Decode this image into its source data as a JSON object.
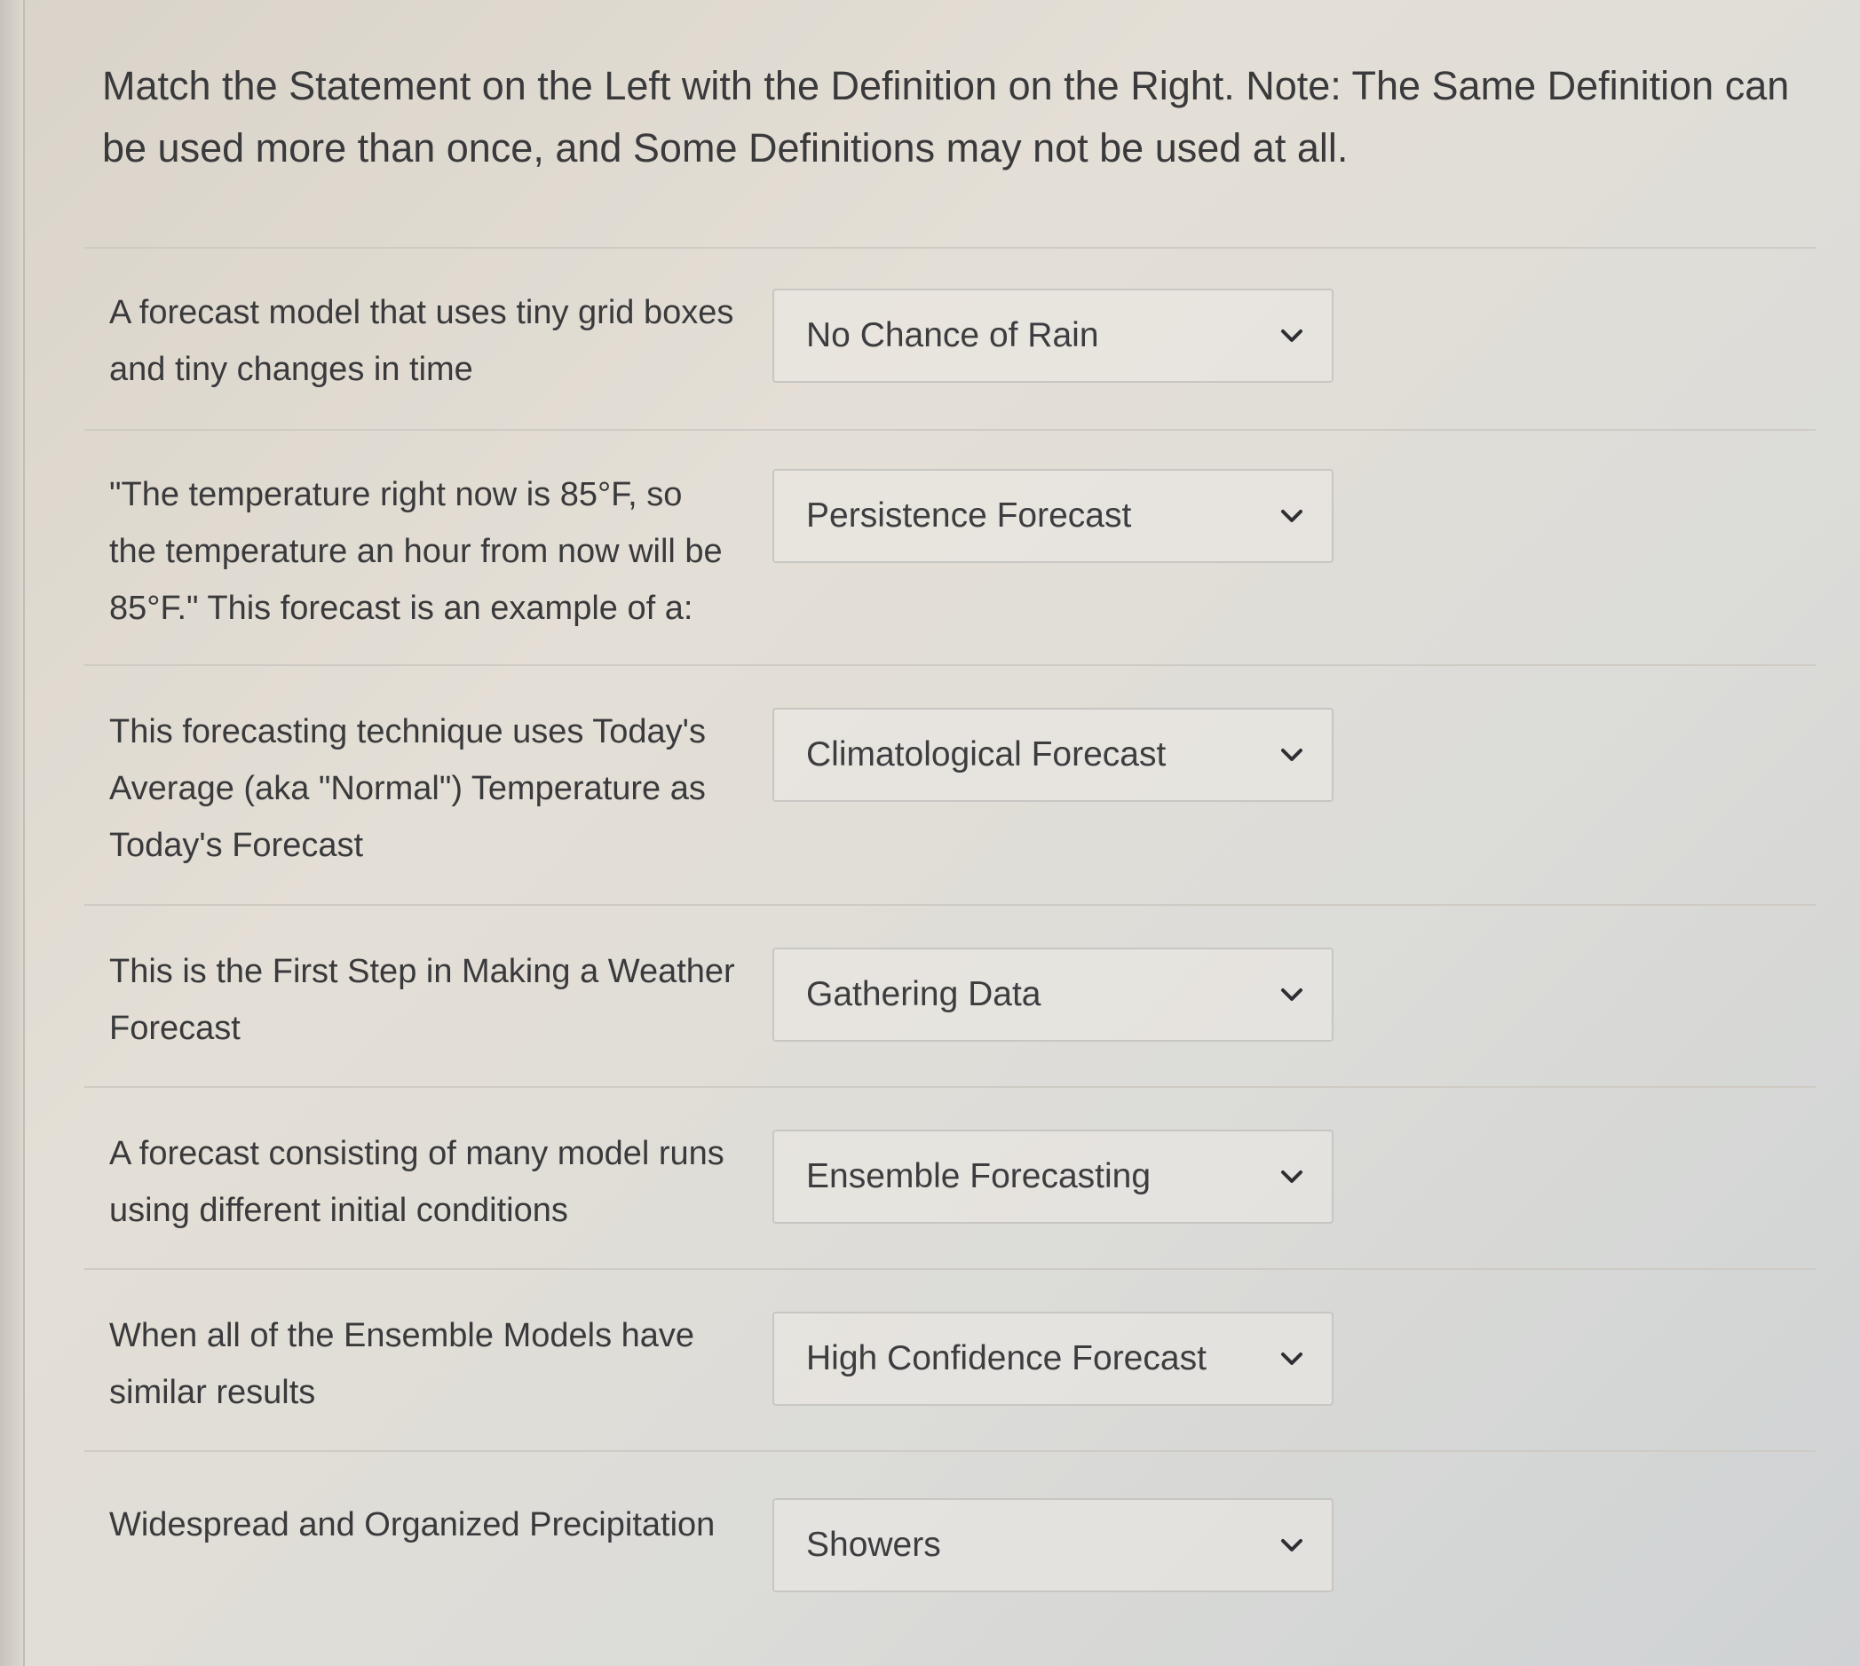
{
  "instructions": "Match the Statement on the Left with the Definition on the Right. Note: The Same Definition can be used more than once, and Some Definitions may not be used at all.",
  "matches": [
    {
      "statement_lines": [
        "A forecast model that uses tiny grid boxes",
        "and tiny changes in time"
      ],
      "selected": "No Chance of Rain"
    },
    {
      "statement_lines": [
        "\"The temperature right now is 85°F, so",
        "the temperature an hour from now will be",
        "85°F.\" This forecast is an example of a:"
      ],
      "selected": "Persistence Forecast"
    },
    {
      "statement_lines": [
        "This forecasting technique uses Today's",
        "Average (aka \"Normal\") Temperature as",
        "Today's Forecast"
      ],
      "selected": "Climatological Forecast"
    },
    {
      "statement_lines": [
        "This is the First Step in Making a Weather",
        "Forecast"
      ],
      "selected": "Gathering Data"
    },
    {
      "statement_lines": [
        "A forecast consisting of many model runs",
        "using different initial conditions"
      ],
      "selected": "Ensemble Forecasting"
    },
    {
      "statement_lines": [
        "When all of the Ensemble Models have",
        "similar results"
      ],
      "selected": "High Confidence Forecast"
    },
    {
      "statement_lines": [
        "Widespread and Organized Precipitation"
      ],
      "selected": "Showers"
    }
  ],
  "icons": {
    "dropdown": "chevron-down-icon"
  }
}
